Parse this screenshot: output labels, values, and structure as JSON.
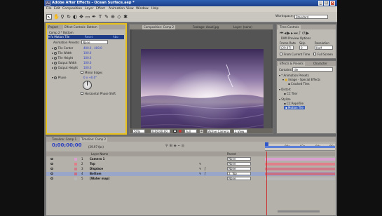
{
  "app": {
    "title": "Adobe After Effects - Ocean Surface.aep *",
    "menu": [
      "File",
      "Edit",
      "Composition",
      "Layer",
      "Effect",
      "Animation",
      "View",
      "Window",
      "Help"
    ],
    "workspace_label": "Workspace:",
    "workspace_value": "Standard"
  },
  "effect_controls": {
    "tabs": [
      "Project",
      "Effect Controls: Bottom"
    ],
    "header": "Comp 2 * Bottom",
    "effect_name": "Motion Tile",
    "reset_label": "Reset",
    "about_label": "Abo",
    "preset_label": "Animation Presets:",
    "preset_value": "None",
    "params": [
      {
        "name": "Tile Center",
        "value": "400.0 , 400.0"
      },
      {
        "name": "Tile Width",
        "value": "100.0"
      },
      {
        "name": "Tile Height",
        "value": "100.0"
      },
      {
        "name": "Output Width",
        "value": "100.0"
      },
      {
        "name": "Output Height",
        "value": "100.0"
      }
    ],
    "mirror_edges": "Mirror Edges",
    "phase_label": "Phase",
    "phase_value": "0 x +0.0°",
    "horizontal_phase": "Horizontal Phase Shift"
  },
  "composition": {
    "tabs": [
      "Composition: Comp 2",
      "Footage: cloud.jpg",
      "Layer: (none)"
    ],
    "zoom": "50%",
    "timecode": "0;00;00;00",
    "resolution": "Full",
    "camera": "Active Camera",
    "view": "1 View"
  },
  "time_controls": {
    "title": "Time Controls",
    "ram_preview": "RAM Preview Options",
    "frame_rate_label": "Frame Rate",
    "skip_label": "Skip",
    "resolution_label": "Resolution",
    "frame_rate": "(29.97)",
    "skip": "0",
    "resolution": "Half",
    "from_current": "From Current Time",
    "full_screen": "Full Screen"
  },
  "effects_presets": {
    "tabs": [
      "Effects & Presets",
      "Character"
    ],
    "contains_label": "Contains:",
    "search": "tile",
    "tree": [
      {
        "label": "* Animation Presets",
        "level": 0,
        "selected": false
      },
      {
        "label": "Image - Special Effects",
        "level": 1,
        "selected": false
      },
      {
        "label": "Cracked Tiles",
        "level": 2,
        "selected": false
      },
      {
        "label": "Distort",
        "level": 0,
        "selected": false
      },
      {
        "label": "CC Tiler",
        "level": 1,
        "selected": false
      },
      {
        "label": "Stylize",
        "level": 0,
        "selected": false
      },
      {
        "label": "CC RepeTile",
        "level": 1,
        "selected": false
      },
      {
        "label": "Motion Tile",
        "level": 1,
        "selected": true
      }
    ]
  },
  "timeline": {
    "tabs": [
      "Timeline: Comp 1",
      "Timeline: Comp 2"
    ],
    "timecode": "0;00;00;00",
    "fps": "(29.97 fps)",
    "col_layer": "Layer Name",
    "col_parent": "Parent",
    "ruler": [
      "00s",
      "02s",
      "04s",
      "06s"
    ],
    "layers": [
      {
        "num": "1",
        "name": "Camera 1",
        "parent": "None",
        "color": "#d9a0d0",
        "selected": false
      },
      {
        "num": "2",
        "name": "Top",
        "parent": "None",
        "color": "#e07f8a",
        "selected": false
      },
      {
        "num": "3",
        "name": "Displace",
        "parent": "None",
        "color": "#cf7a88",
        "selected": false
      },
      {
        "num": "4",
        "name": "Bottom",
        "parent": "2. Top",
        "color": "#c86f84",
        "selected": true
      },
      {
        "num": "5",
        "name": "[Water map]",
        "parent": "None",
        "color": "#b8b8b8",
        "selected": false
      }
    ]
  }
}
